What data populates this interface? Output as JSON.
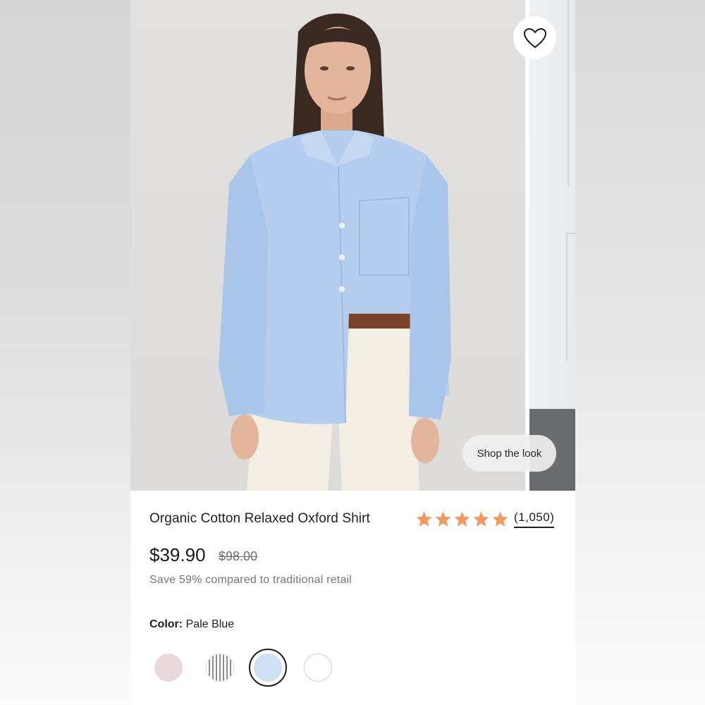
{
  "product": {
    "title": "Organic Cotton Relaxed Oxford Shirt",
    "rating_stars": 5,
    "review_count": "(1,050)",
    "price": "$39.90",
    "original_price": "$98.00",
    "savings_note": "Save 59% compared to traditional retail",
    "color_label": "Color:",
    "color_value": "Pale Blue",
    "selected_swatch_index": 2
  },
  "actions": {
    "shop_the_look": "Shop the look",
    "favorite_icon": "heart-icon"
  },
  "swatches": [
    {
      "name": "pink-swatch",
      "color": "#ead9dc"
    },
    {
      "name": "stripe-swatch",
      "color": "#9a9a9a"
    },
    {
      "name": "pale-blue-swatch",
      "color": "#cfe0f5"
    },
    {
      "name": "white-swatch",
      "color": "#ffffff"
    }
  ],
  "colors": {
    "star": "#ef9a62",
    "text": "#1e1e1e",
    "muted": "#777777"
  }
}
